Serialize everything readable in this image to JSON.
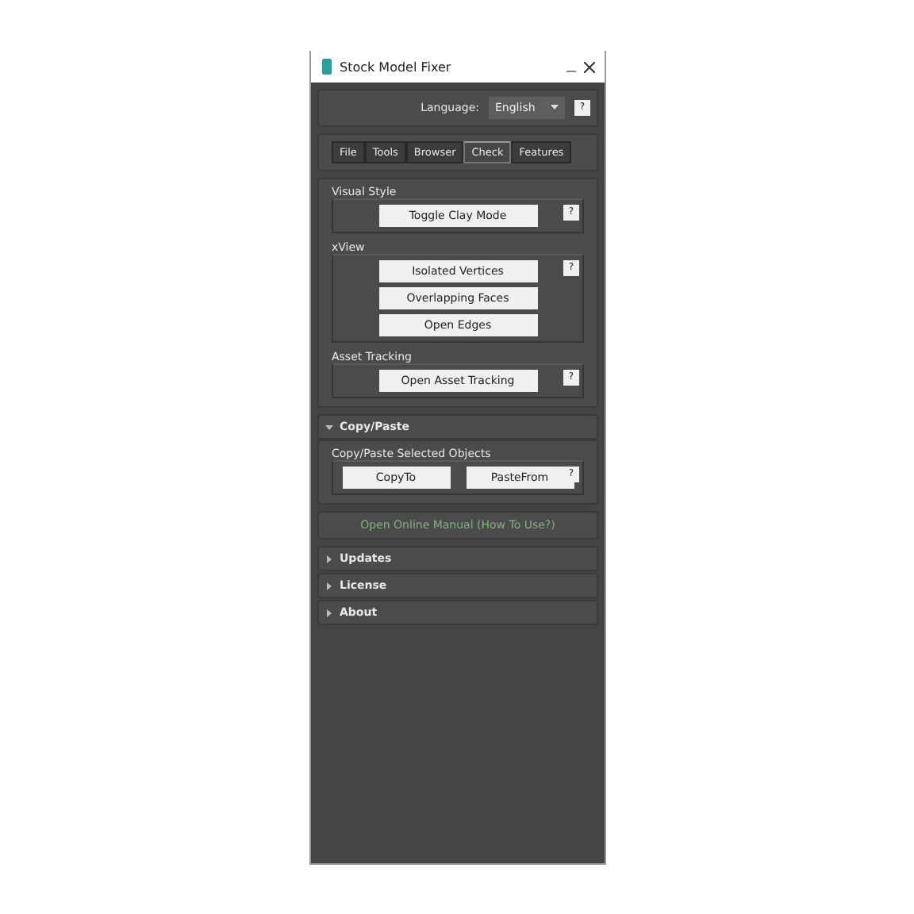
{
  "window": {
    "title": "Stock Model Fixer"
  },
  "language": {
    "label": "Language:",
    "value": "English",
    "help": "?"
  },
  "tabs": [
    {
      "label": "File",
      "selected": false
    },
    {
      "label": "Tools",
      "selected": false
    },
    {
      "label": "Browser",
      "selected": false
    },
    {
      "label": "Check",
      "selected": true
    },
    {
      "label": "Features",
      "selected": false
    }
  ],
  "check_groups": [
    {
      "title": "Visual Style",
      "help": "?",
      "buttons": [
        "Toggle Clay Mode"
      ]
    },
    {
      "title": "xView",
      "help": "?",
      "buttons": [
        "Isolated Vertices",
        "Overlapping Faces",
        "Open Edges"
      ]
    },
    {
      "title": "Asset Tracking",
      "help": "?",
      "buttons": [
        "Open Asset Tracking"
      ]
    }
  ],
  "copy_paste": {
    "title": "Copy/Paste",
    "expanded": true,
    "group_title": "Copy/Paste Selected Objects",
    "help": "?",
    "buttons": [
      "CopyTo",
      "PasteFrom"
    ]
  },
  "manual_link": "Open Online Manual (How To Use?)",
  "rollouts": [
    {
      "title": "Updates",
      "expanded": false
    },
    {
      "title": "License",
      "expanded": false
    },
    {
      "title": "About",
      "expanded": false
    }
  ]
}
